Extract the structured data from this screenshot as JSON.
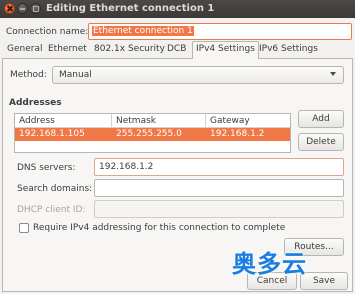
{
  "window": {
    "title": "Editing Ethernet connection 1"
  },
  "connection_name": {
    "label": "Connection name:",
    "value": "Ethernet connection 1"
  },
  "tabs": [
    {
      "label": "General"
    },
    {
      "label": "Ethernet"
    },
    {
      "label": "802.1x Security"
    },
    {
      "label": "DCB"
    },
    {
      "label": "IPv4 Settings",
      "active": true
    },
    {
      "label": "IPv6 Settings"
    }
  ],
  "method": {
    "label": "Method:",
    "value": "Manual"
  },
  "addresses": {
    "heading": "Addresses",
    "columns": [
      "Address",
      "Netmask",
      "Gateway"
    ],
    "rows": [
      {
        "address": "192.168.1.105",
        "netmask": "255.255.255.0",
        "gateway": "192.168.1.2"
      }
    ],
    "add_label": "Add",
    "delete_label": "Delete"
  },
  "dns": {
    "label": "DNS servers:",
    "value": "192.168.1.2"
  },
  "search_domains": {
    "label": "Search domains:",
    "value": ""
  },
  "dhcp_client_id": {
    "label": "DHCP client ID:",
    "value": ""
  },
  "require_ipv4": {
    "label": "Require IPv4 addressing for this connection to complete",
    "checked": false
  },
  "buttons": {
    "routes": "Routes...",
    "cancel": "Cancel",
    "save": "Save"
  },
  "watermark": "奥多云",
  "colors": {
    "accent": "#f07746",
    "titlebar": "#3c3b37",
    "watermark": "#1a7de0"
  }
}
